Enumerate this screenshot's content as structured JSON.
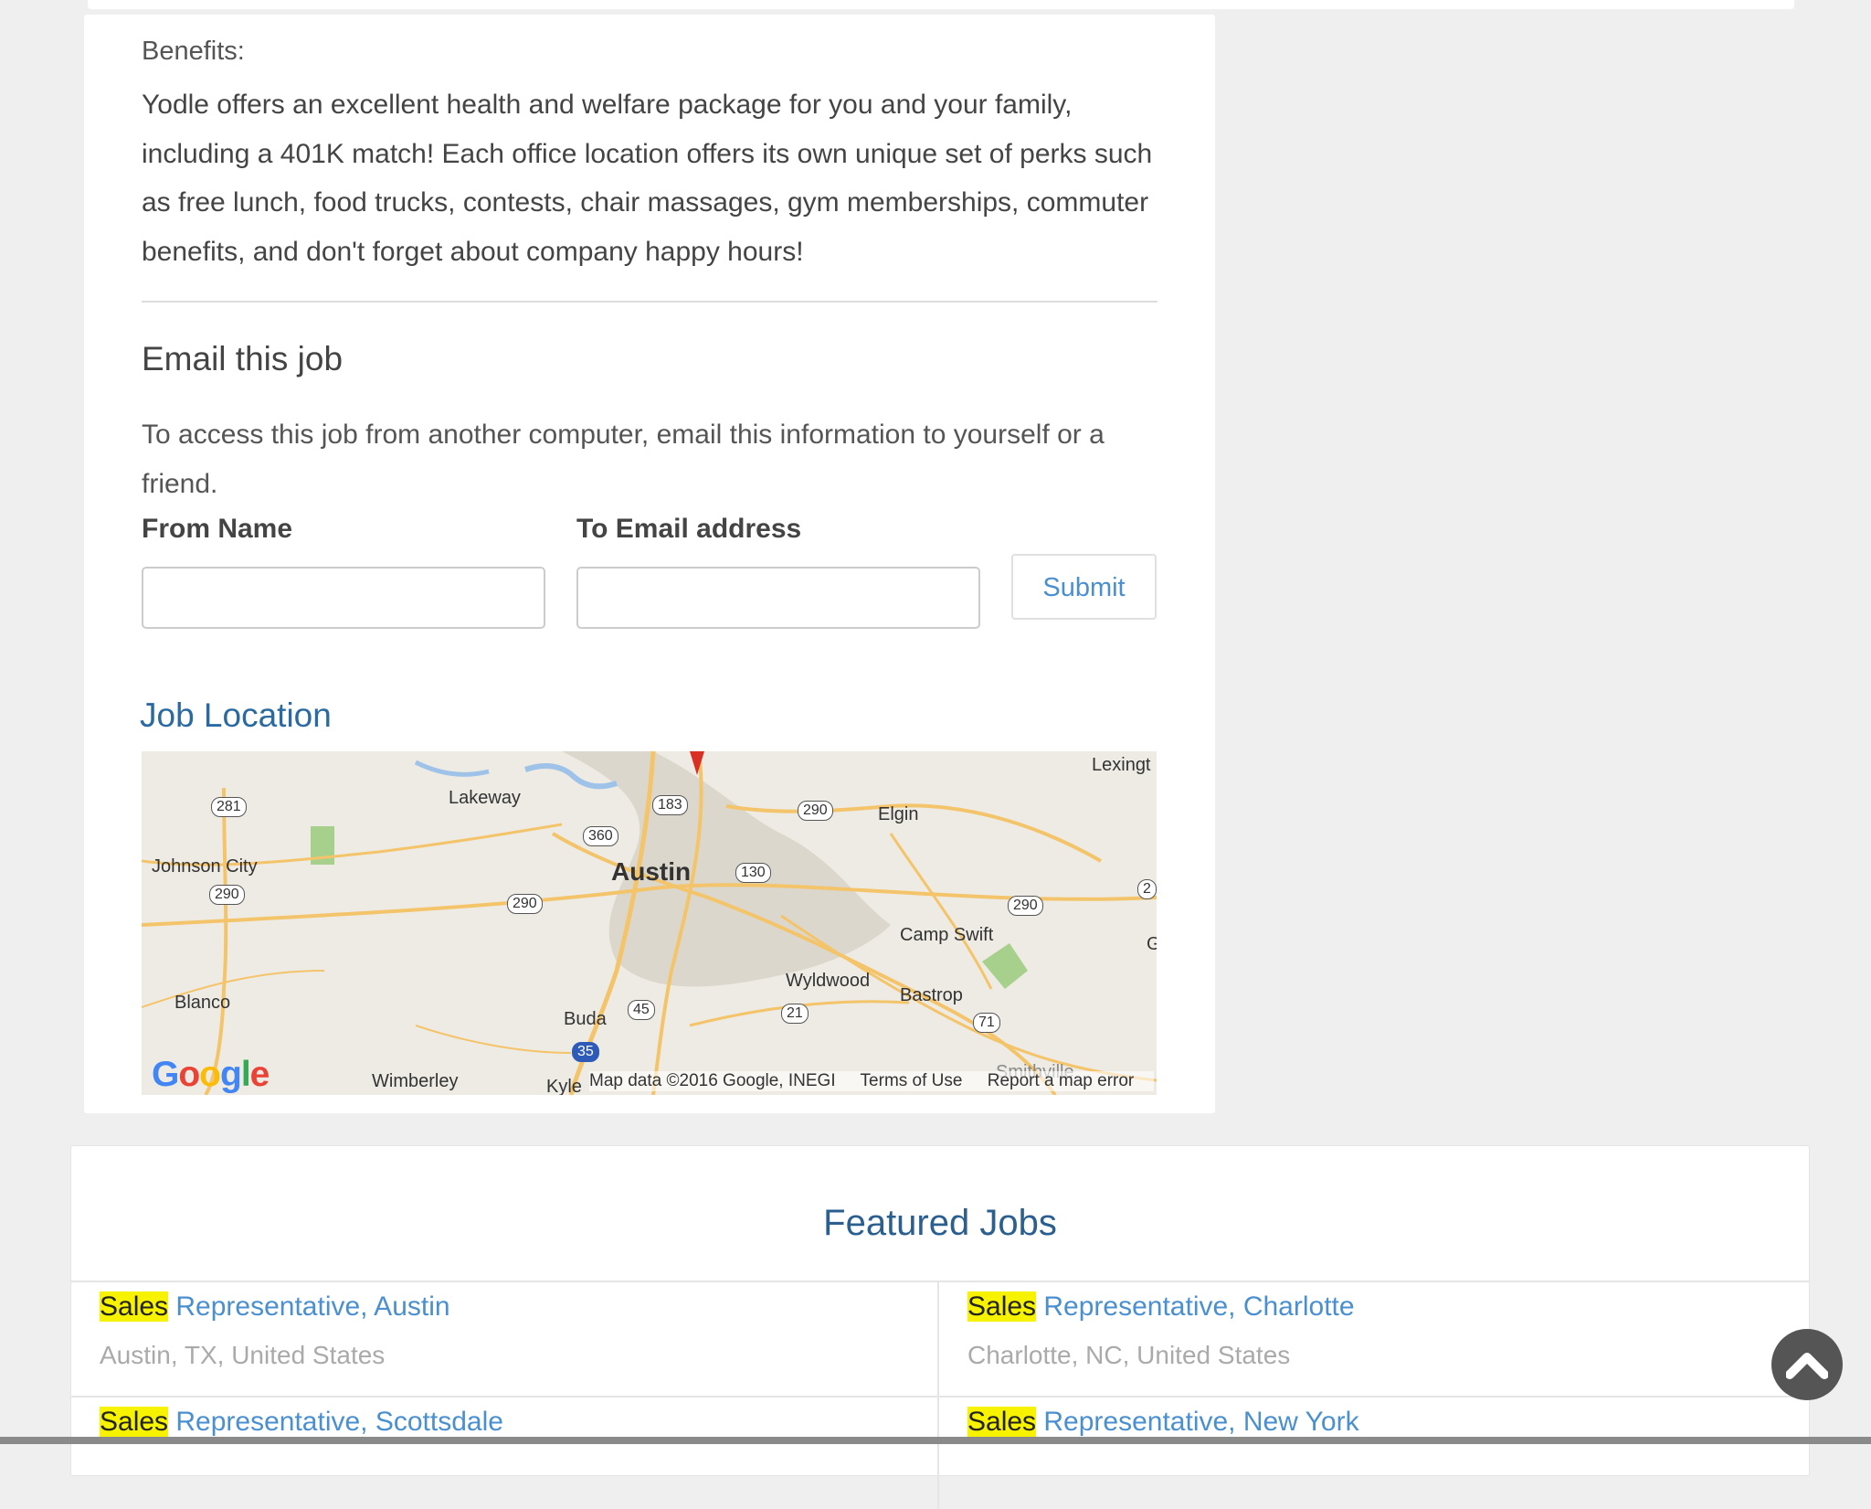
{
  "job": {
    "benefits_label": "Benefits:",
    "benefits_text": "Yodle offers an excellent health and welfare package for you and your family, including a 401K match! Each office location offers its own unique set of perks such as free lunch, food trucks, contests, chair massages, gym memberships, commuter benefits, and don't forget about company happy hours!"
  },
  "email": {
    "heading": "Email this job",
    "description": "To access this job from another computer, email this information to yourself or a friend.",
    "from_label": "From Name",
    "from_value": "",
    "to_label": "To Email address",
    "to_value": "",
    "submit_label": "Submit"
  },
  "location": {
    "heading": "Job Location",
    "map": {
      "places": [
        "Lexingt",
        "Lakeway",
        "Elgin",
        "Johnson City",
        "Austin",
        "Camp Swift",
        "Wyldwood",
        "Bastrop",
        "Blanco",
        "Buda",
        "Wimberley",
        "Kyle",
        "Smithville",
        "G"
      ],
      "routes": [
        "281",
        "183",
        "290",
        "360",
        "130",
        "290",
        "290",
        "290",
        "45",
        "21",
        "71",
        "35",
        "2"
      ],
      "attribution": "Map data ©2016 Google, INEGI",
      "terms": "Terms of Use",
      "report": "Report a map error"
    }
  },
  "featured": {
    "heading": "Featured Jobs",
    "jobs": [
      {
        "highlight": "Sales",
        "title_rest": " Representative, Austin",
        "location": "Austin, TX, United States"
      },
      {
        "highlight": "Sales",
        "title_rest": " Representative, Charlotte",
        "location": "Charlotte, NC, United States"
      },
      {
        "highlight": "Sales",
        "title_rest": " Representative, Scottsdale",
        "location": ""
      },
      {
        "highlight": "Sales",
        "title_rest": " Representative, New York",
        "location": ""
      }
    ]
  },
  "icons": {
    "scroll_top": "chevron-up-icon"
  },
  "colors": {
    "link": "#4a8fd0",
    "heading_blue": "#2b6aa0",
    "highlight": "#f6f200",
    "background": "#efefef"
  }
}
